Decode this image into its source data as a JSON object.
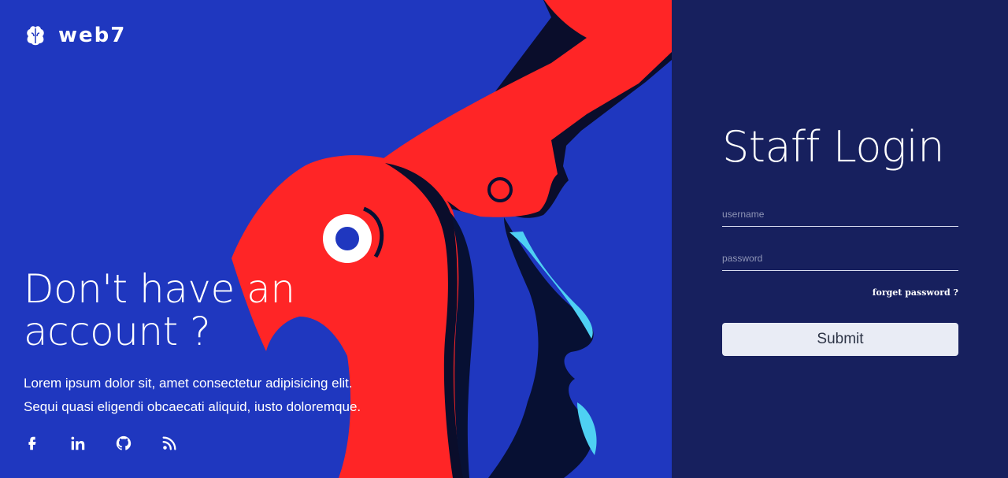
{
  "brand": {
    "name": "web7",
    "icon": "brain-icon"
  },
  "hero": {
    "heading": "Don't have an account ?",
    "description_line1": "Lorem ipsum dolor sit, amet consectetur adipisicing elit.",
    "description_line2": "Sequi quasi eligendi obcaecati aliquid, iusto doloremque."
  },
  "social": [
    {
      "icon": "facebook-icon"
    },
    {
      "icon": "linkedin-icon"
    },
    {
      "icon": "github-icon"
    },
    {
      "icon": "rss-icon"
    }
  ],
  "login": {
    "title": "Staff Login",
    "username_placeholder": "username",
    "password_placeholder": "password",
    "forgot_label": "forget password ?",
    "submit_label": "Submit"
  },
  "colors": {
    "hero_background": "#1f37bf",
    "panel_background": "#17205e",
    "accent_red": "#ff2526",
    "accent_cyan": "#4ed0f3",
    "button_background": "#e9ecf5"
  }
}
